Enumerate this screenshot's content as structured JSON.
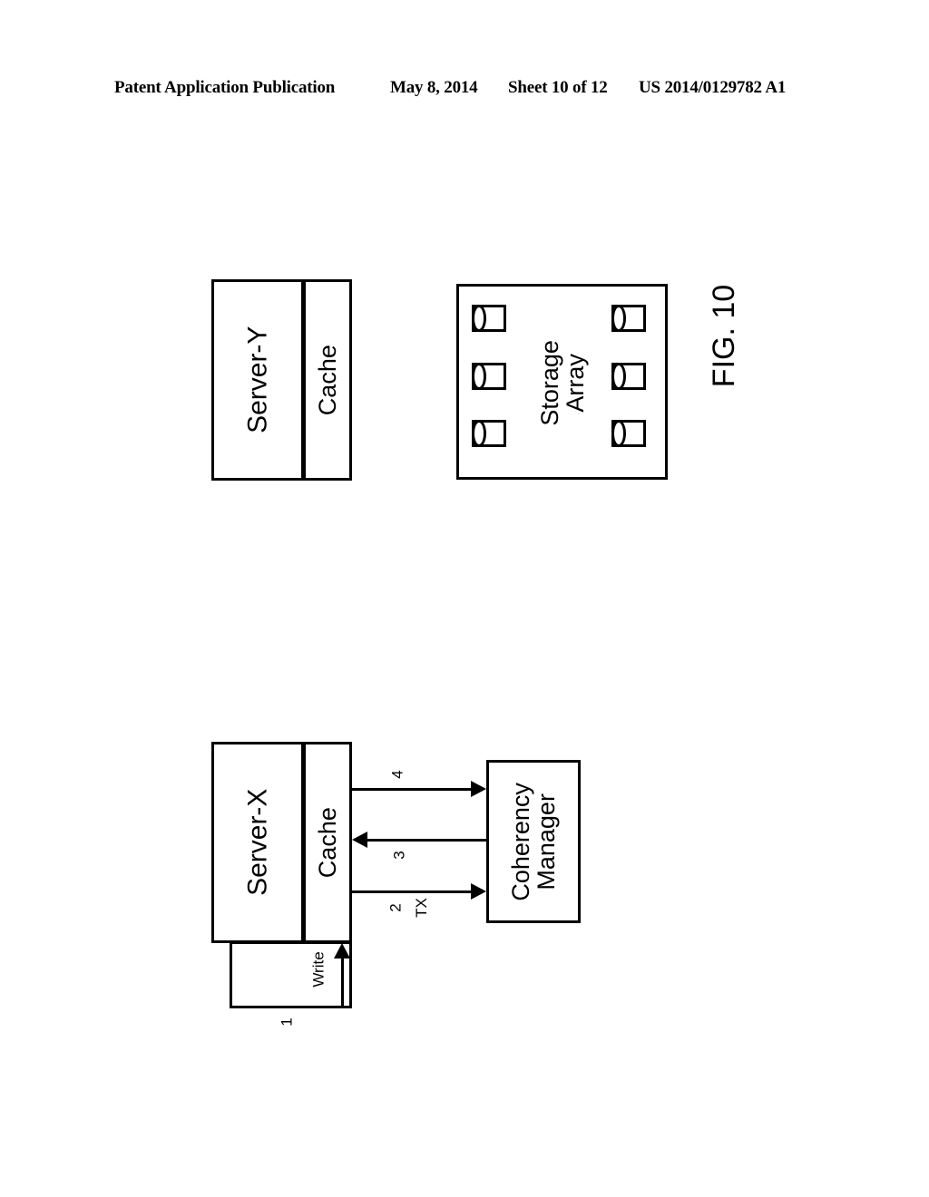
{
  "header": {
    "publication": "Patent Application Publication",
    "date": "May 8, 2014",
    "sheet": "Sheet 10 of 12",
    "patent_number": "US 2014/0129782 A1"
  },
  "figure": {
    "caption": "FIG. 10"
  },
  "top_diagram": {
    "server": {
      "label": "Server-Y",
      "cache_label": "Cache"
    },
    "storage_array": {
      "label_line1": "Storage",
      "label_line2": "Array",
      "disk_count": 6,
      "disk_name": "disk-cylinder"
    }
  },
  "bottom_diagram": {
    "server": {
      "label": "Server-X",
      "cache_label": "Cache"
    },
    "coherency_manager": {
      "label_line1": "Coherency",
      "label_line2": "Manager"
    },
    "flows": [
      {
        "id": "1",
        "number": "1",
        "label": "Write",
        "direction": "up",
        "from": "source",
        "to": "cache"
      },
      {
        "id": "2",
        "number": "2",
        "label": "TX",
        "direction": "right",
        "from": "cache",
        "to": "coherency-manager"
      },
      {
        "id": "3",
        "number": "3",
        "label": "",
        "direction": "left",
        "from": "coherency-manager",
        "to": "cache"
      },
      {
        "id": "4",
        "number": "4",
        "label": "",
        "direction": "right",
        "from": "cache",
        "to": "coherency-manager"
      }
    ]
  },
  "colors": {
    "line": "#000000",
    "background": "#ffffff"
  }
}
